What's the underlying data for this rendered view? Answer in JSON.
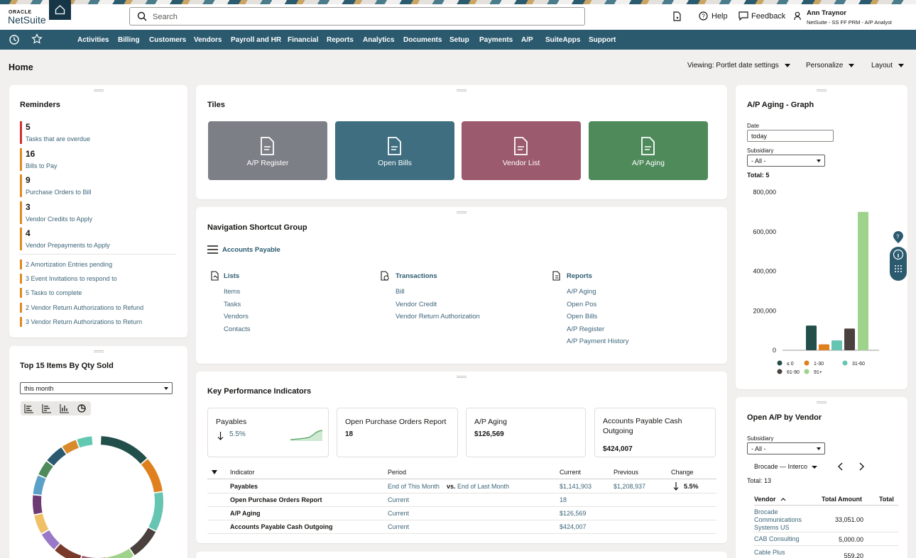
{
  "header": {
    "brand_top": "ORACLE",
    "brand_bottom": "NetSuite",
    "search_placeholder": "Search",
    "help": "Help",
    "feedback": "Feedback",
    "user_name": "Ann Traynor",
    "user_role": "NetSuite - SS FF PRM - A/P Analyst"
  },
  "nav": [
    "Activities",
    "Billing",
    "Customers",
    "Vendors",
    "Payroll and HR",
    "Financial",
    "Reports",
    "Analytics",
    "Documents",
    "Setup",
    "Payments",
    "A/P",
    "SuiteApps",
    "Support"
  ],
  "page": {
    "title": "Home",
    "viewing": "Viewing: Portlet date settings",
    "personalize": "Personalize",
    "layout": "Layout"
  },
  "reminders": {
    "title": "Reminders",
    "items": [
      {
        "count": "5",
        "label": "Tasks that are overdue",
        "color": "#d3302f"
      },
      {
        "count": "16",
        "label": "Bills to Pay",
        "color": "#e08a1e"
      },
      {
        "count": "9",
        "label": "Purchase Orders to Bill",
        "color": "#e08a1e"
      },
      {
        "count": "3",
        "label": "Vendor Credits to Apply",
        "color": "#e08a1e"
      },
      {
        "count": "4",
        "label": "Vendor Prepayments to Apply",
        "color": "#e08a1e"
      }
    ],
    "small": [
      "2  Amortization Entries pending",
      "3  Event Invitations to respond to",
      "5  Tasks to complete",
      "2  Vendor Return Authorizations to Refund",
      "3  Vendor Return Authorizations to Return"
    ]
  },
  "top15": {
    "title": "Top 15 Items By Qty Sold",
    "period": "this month"
  },
  "tiles": {
    "title": "Tiles",
    "items": [
      {
        "label": "A/P Register",
        "color": "#7c8086"
      },
      {
        "label": "Open Bills",
        "color": "#3e6e80"
      },
      {
        "label": "Vendor List",
        "color": "#9c5a6e"
      },
      {
        "label": "A/P Aging",
        "color": "#4e8a5a"
      }
    ]
  },
  "nsg": {
    "title": "Navigation Shortcut Group",
    "group": "Accounts Payable",
    "lists_title": "Lists",
    "lists": [
      "Items",
      "Tasks",
      "Vendors",
      "Contacts"
    ],
    "trans_title": "Transactions",
    "trans": [
      "Bill",
      "Vendor Credit",
      "Vendor Return Authorization"
    ],
    "reports_title": "Reports",
    "reports": [
      "A/P Aging",
      "Open Pos",
      "Open Bills",
      "A/P Register",
      "A/P Payment History"
    ]
  },
  "kpi": {
    "title": "Key Performance Indicators",
    "cards": [
      {
        "title": "Payables",
        "value": "5.5%"
      },
      {
        "title": "Open Purchase Orders Report",
        "value": "18"
      },
      {
        "title": "A/P Aging",
        "value": "$126,569"
      },
      {
        "title": "Accounts Payable Cash Outgoing",
        "value": "$424,007"
      }
    ],
    "headers": [
      "Indicator",
      "Period",
      "Current",
      "Previous",
      "Change"
    ],
    "rows": [
      {
        "indicator": "Payables",
        "period_a": "End of This Month",
        "vs": "vs.",
        "period_b": "End of Last Month",
        "current": "$1,141,903",
        "previous": "$1,208,937",
        "change": "5.5%"
      },
      {
        "indicator": "Open Purchase Orders Report",
        "period_a": "Current",
        "current": "18"
      },
      {
        "indicator": "A/P Aging",
        "period_a": "Current",
        "current": "$126,569"
      },
      {
        "indicator": "Accounts Payable Cash Outgoing",
        "period_a": "Current",
        "current": "$424,007"
      }
    ]
  },
  "aging": {
    "title": "A/P Aging - Graph",
    "date_label": "Date",
    "date_value": "today",
    "subsidiary_label": "Subsidiary",
    "subsidiary_value": "- All -",
    "total": "Total: 5"
  },
  "chart_data": {
    "type": "bar",
    "categories": [
      "≤ 0",
      "1-30",
      "31-60",
      "61-90",
      "91+"
    ],
    "values": [
      125000,
      30000,
      50000,
      110000,
      700000
    ],
    "colors": [
      "#234f4b",
      "#e07f1e",
      "#66c4b2",
      "#4a403d",
      "#9fd28a"
    ],
    "ylim": [
      0,
      800000
    ],
    "yticks": [
      "0",
      "200,000",
      "400,000",
      "600,000",
      "800,000"
    ]
  },
  "openap": {
    "title": "Open A/P by Vendor",
    "subsidiary_label": "Subsidiary",
    "subsidiary_value": "- All -",
    "vendor_filter": "Brocade — Interco",
    "total": "Total: 13",
    "headers": [
      "Vendor",
      "Total Amount",
      "Total"
    ],
    "rows": [
      {
        "vendor": "Brocade Communications Systems US",
        "amount": "33,051.00"
      },
      {
        "vendor": "CAB Consulting",
        "amount": "5,000.00"
      },
      {
        "vendor": "Cable Plus",
        "amount": "559.20"
      }
    ]
  }
}
